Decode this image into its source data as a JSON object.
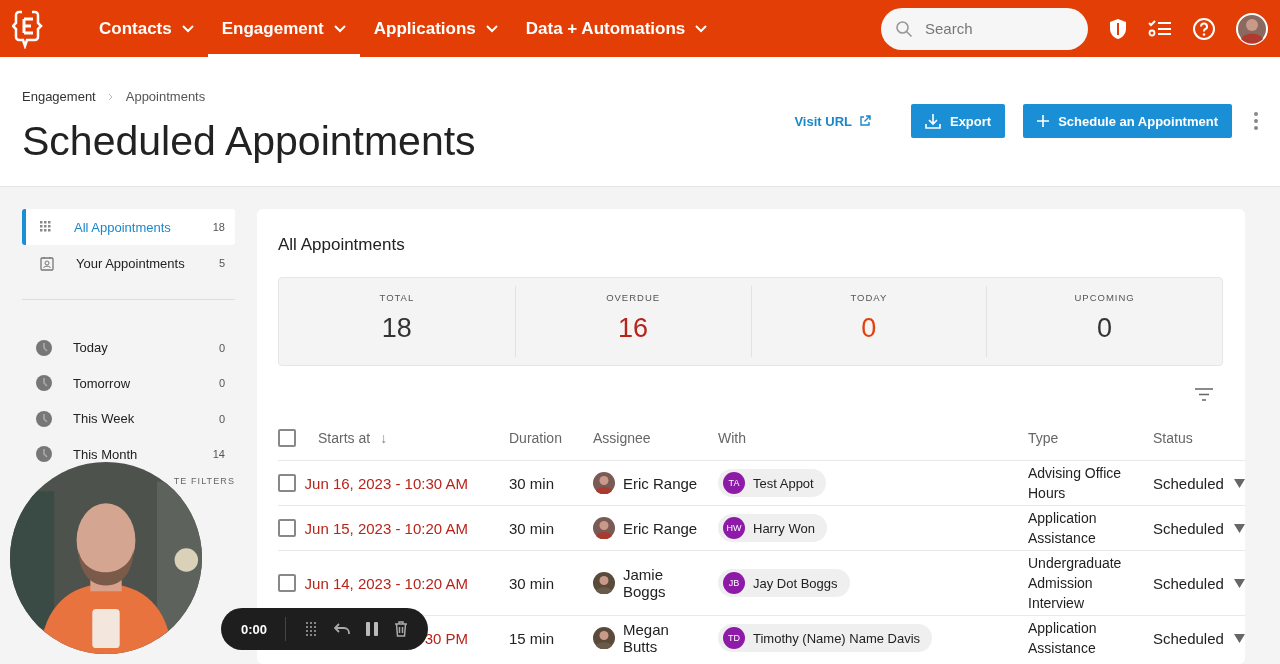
{
  "nav": {
    "items": [
      {
        "label": "Contacts",
        "selected": false
      },
      {
        "label": "Engagement",
        "selected": true
      },
      {
        "label": "Applications",
        "selected": false
      },
      {
        "label": "Data + Automations",
        "selected": false
      }
    ],
    "search": {
      "placeholder": "Search"
    }
  },
  "breadcrumb": [
    "Engagement",
    "Appointments"
  ],
  "title": "Scheduled Appointments",
  "actions": {
    "visit_url": "Visit URL",
    "export": "Export",
    "schedule": "Schedule an Appointment"
  },
  "sidebar": {
    "views": [
      {
        "kind": "grid",
        "label": "All Appointments",
        "count": "18",
        "selected": true
      },
      {
        "kind": "person",
        "label": "Your Appointments",
        "count": "5",
        "selected": false
      }
    ],
    "periods": [
      {
        "label": "Today",
        "count": "0"
      },
      {
        "label": "Tomorrow",
        "count": "0"
      },
      {
        "label": "This Week",
        "count": "0"
      },
      {
        "label": "This Month",
        "count": "14"
      }
    ],
    "section_label": "TE FILTERS"
  },
  "card": {
    "title": "All Appointments",
    "stats": [
      {
        "label": "TOTAL",
        "value": "18",
        "color": "#333333"
      },
      {
        "label": "OVERDUE",
        "value": "16",
        "color": "#b8231a"
      },
      {
        "label": "TODAY",
        "value": "0",
        "color": "#e0420f"
      },
      {
        "label": "UPCOMING",
        "value": "0",
        "color": "#333333"
      }
    ],
    "table": {
      "all_selected": false,
      "columns": [
        {
          "label": "Starts at",
          "sort": "↓"
        },
        {
          "label": "Duration"
        },
        {
          "label": "Assignee"
        },
        {
          "label": "With"
        },
        {
          "label": "Type"
        },
        {
          "label": "Status"
        }
      ],
      "rows": [
        {
          "selected": false,
          "starts_at": "Jun 16, 2023 - 10:30 AM",
          "overdue": true,
          "duration": "30 min",
          "assignee": "Eric Range",
          "with": {
            "initials": "TA",
            "name": "Test Appot"
          },
          "type": "Advising Office Hours",
          "status": "Scheduled"
        },
        {
          "selected": false,
          "starts_at": "Jun 15, 2023 - 10:20 AM",
          "overdue": true,
          "duration": "30 min",
          "assignee": "Eric Range",
          "with": {
            "initials": "HW",
            "name": "Harry Won"
          },
          "type": "Application Assistance",
          "status": "Scheduled"
        },
        {
          "selected": false,
          "starts_at": "Jun 14, 2023 - 10:20 AM",
          "overdue": true,
          "duration": "30 min",
          "assignee": "Jamie Boggs",
          "with": {
            "initials": "JB",
            "name": "Jay Dot Boggs"
          },
          "type": "Undergraduate Admission Interview",
          "status": "Scheduled"
        },
        {
          "starts_at": "30 PM",
          "overdue": true,
          "duration": "15 min",
          "assignee": "Megan Butts",
          "with": {
            "initials": "TD",
            "name": "Timothy (Name) Name Davis"
          },
          "type": "Application Assistance",
          "status": "Scheduled"
        }
      ]
    }
  },
  "recorder": {
    "time": "0:00"
  }
}
